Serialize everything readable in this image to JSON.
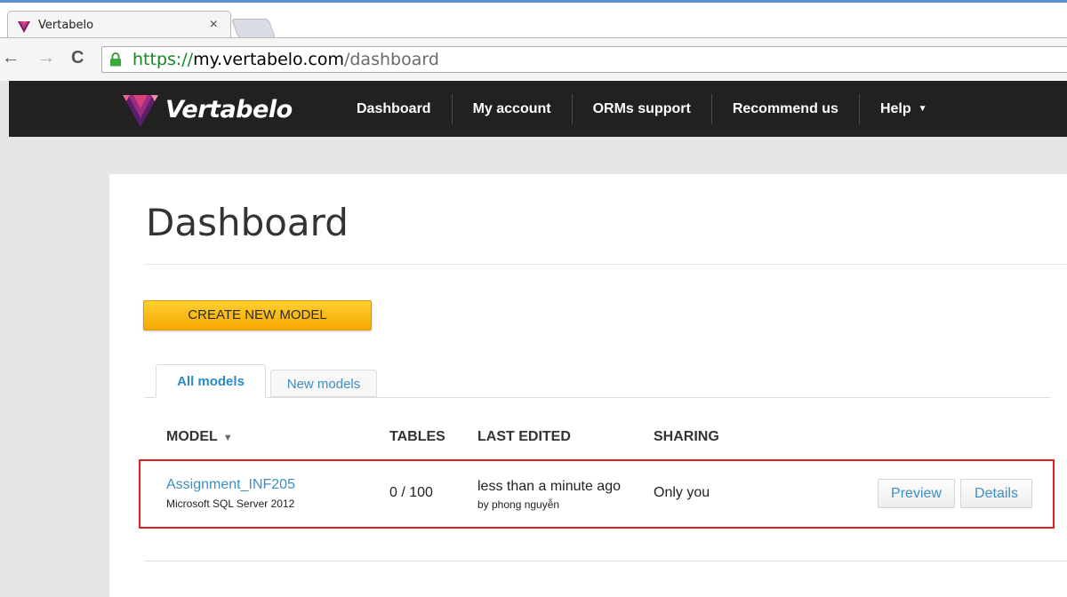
{
  "browser": {
    "tab_title": "Vertabelo",
    "close_glyph": "×",
    "url": {
      "scheme": "https://",
      "host": "my.vertabelo.com",
      "path": "/dashboard"
    },
    "back_glyph": "←",
    "forward_glyph": "→",
    "reload_glyph": "C"
  },
  "brand": {
    "name": "Vertabelo"
  },
  "nav": {
    "items": [
      {
        "label": "Dashboard"
      },
      {
        "label": "My account"
      },
      {
        "label": "ORMs support"
      },
      {
        "label": "Recommend us"
      },
      {
        "label": "Help"
      }
    ]
  },
  "page": {
    "title": "Dashboard",
    "create_button": "CREATE NEW MODEL",
    "tabs": [
      {
        "label": "All models",
        "active": true
      },
      {
        "label": "New models",
        "active": false
      }
    ]
  },
  "table": {
    "headers": {
      "model": "MODEL",
      "sort_glyph": "▼",
      "tables": "TABLES",
      "last_edited": "LAST EDITED",
      "sharing": "SHARING"
    },
    "rows": [
      {
        "name": "Assignment_INF205",
        "db": "Microsoft SQL Server 2012",
        "tables": "0 / 100",
        "last_edited": "less than a minute ago",
        "edited_by": "by phong nguyễn",
        "sharing": "Only you",
        "preview_label": "Preview",
        "details_label": "Details"
      }
    ]
  },
  "colors": {
    "accent_link": "#3d8fc0",
    "create_button": "#f7a800",
    "nav_bg": "#212121",
    "highlight_border": "#e01f26",
    "url_scheme": "#138a24"
  },
  "icons": [
    "vertabelo-favicon",
    "close-icon",
    "back-arrow-icon",
    "forward-arrow-icon",
    "reload-icon",
    "lock-icon",
    "vertabelo-logo",
    "chevron-down-icon",
    "sort-down-icon"
  ]
}
